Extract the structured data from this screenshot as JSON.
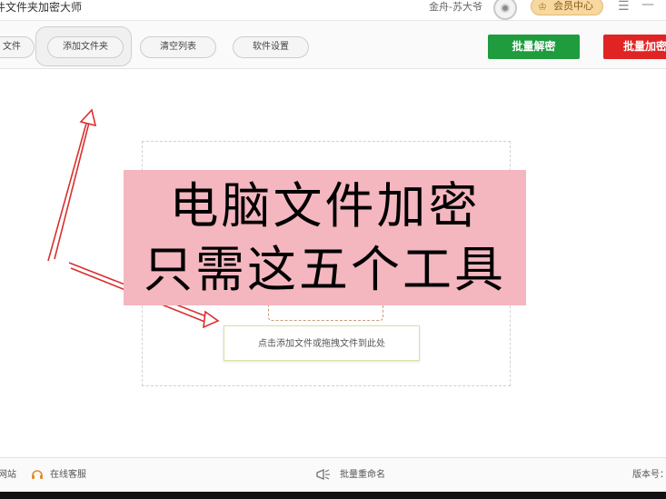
{
  "titlebar": {
    "app_title": "件文件夹加密大师",
    "username": "金舟-苏大爷",
    "member_button": "会员中心",
    "menu_icon": "hamburger-menu-icon",
    "minimize_icon": "minimize-icon"
  },
  "toolbar": {
    "add_file": "文件",
    "add_folder": "添加文件夹",
    "clear_list": "清空列表",
    "settings": "软件设置",
    "batch_decrypt": "批量解密",
    "batch_encrypt": "批量加密"
  },
  "main": {
    "drop_hint": "点击添加文件或拖拽文件到此处",
    "overlay_line1": "电脑文件加密",
    "overlay_line2": "只需这五个工具"
  },
  "statusbar": {
    "website": "网站",
    "online_service": "在线客服",
    "batch_rename": "批量重命名",
    "version": "版本号："
  },
  "colors": {
    "decrypt_green": "#1e9c3e",
    "encrypt_red": "#e02424",
    "overlay_pink": "#f4b6bf",
    "member_gold": "#f7d8a0",
    "arrow_red": "#d9302f"
  }
}
